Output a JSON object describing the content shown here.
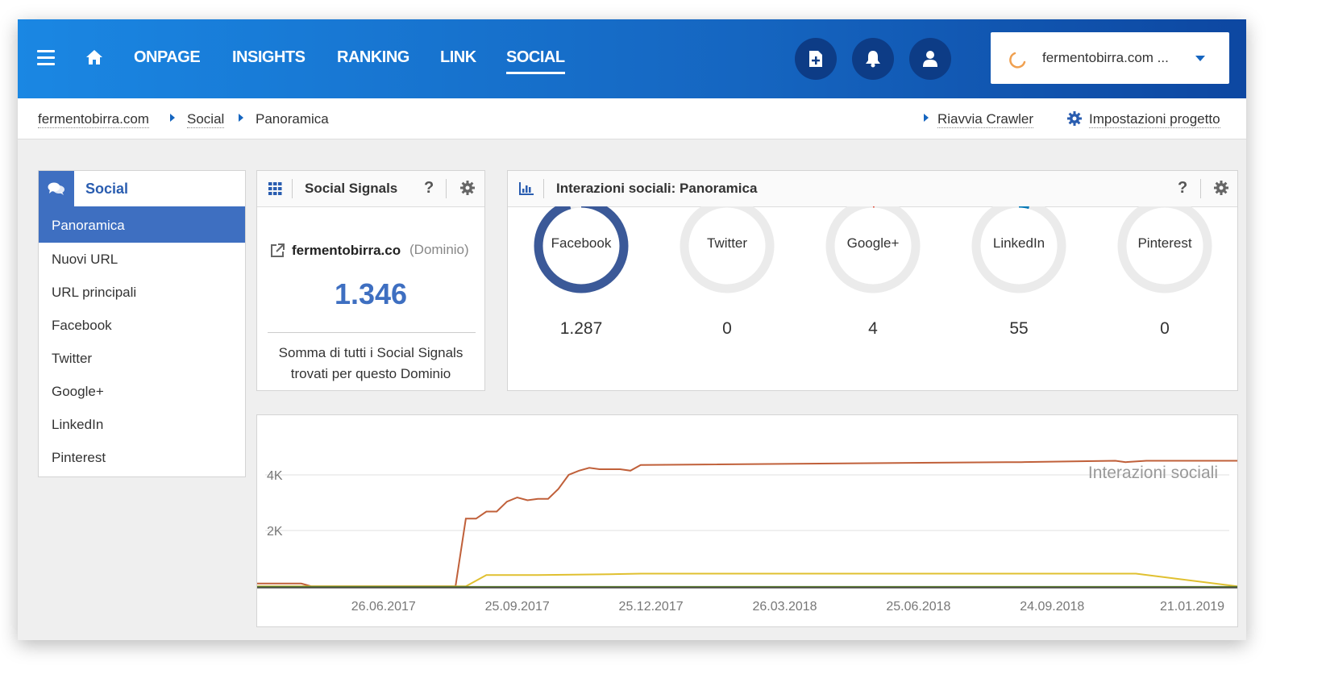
{
  "nav": {
    "items": [
      {
        "label": "ONPAGE",
        "active": false
      },
      {
        "label": "INSIGHTS",
        "active": false
      },
      {
        "label": "RANKING",
        "active": false
      },
      {
        "label": "LINK",
        "active": false
      },
      {
        "label": "SOCIAL",
        "active": true
      }
    ],
    "project": "fermentobirra.com ..."
  },
  "breadcrumb": {
    "items": [
      "fermentobirra.com",
      "Social",
      "Panoramica"
    ],
    "restart": "Riavvia Crawler",
    "settings": "Impostazioni progetto"
  },
  "sidebar": {
    "title": "Social",
    "items": [
      "Panoramica",
      "Nuovi URL",
      "URL principali",
      "Facebook",
      "Twitter",
      "Google+",
      "LinkedIn",
      "Pinterest"
    ],
    "active": "Panoramica"
  },
  "signals": {
    "title": "Social Signals",
    "help": "?",
    "domain": "fermentobirra.co",
    "domain_note": "(Dominio)",
    "value": "1.346",
    "desc_line1": "Somma di tutti i Social Signals",
    "desc_line2": "trovati per questo Dominio"
  },
  "interactions": {
    "title": "Interazioni sociali: Panoramica",
    "help": "?",
    "networks": [
      {
        "name": "Facebook",
        "value": "1.287",
        "share": 0.956,
        "color": "#3b5998"
      },
      {
        "name": "Twitter",
        "value": "0",
        "share": 0,
        "color": "#1da1f2"
      },
      {
        "name": "Google+",
        "value": "4",
        "share": 0.003,
        "color": "#dd4b39"
      },
      {
        "name": "LinkedIn",
        "value": "55",
        "share": 0.041,
        "color": "#0077b5"
      },
      {
        "name": "Pinterest",
        "value": "0",
        "share": 0,
        "color": "#bd081c"
      }
    ]
  },
  "chart_data": {
    "type": "line",
    "title": "Interazioni sociali",
    "x_ticks": [
      "26.06.2017",
      "25.09.2017",
      "25.12.2017",
      "26.03.2018",
      "25.06.2018",
      "24.09.2018",
      "21.01.2019"
    ],
    "y_ticks": [
      "2K",
      "4K"
    ],
    "ylim": [
      0,
      5000
    ],
    "series": [
      {
        "color": "#c0603a",
        "x": [
          "2017-04-01",
          "2017-05-01",
          "2017-05-08",
          "2017-08-14",
          "2017-08-21",
          "2017-08-28",
          "2017-09-04",
          "2017-09-11",
          "2017-09-18",
          "2017-09-25",
          "2017-10-02",
          "2017-10-09",
          "2017-10-16",
          "2017-10-23",
          "2017-10-30",
          "2017-11-06",
          "2017-11-13",
          "2017-11-20",
          "2017-11-27",
          "2017-12-04",
          "2017-12-11",
          "2017-12-18",
          "2018-08-24",
          "2018-09-03",
          "2018-11-06",
          "2018-11-13",
          "2018-11-27",
          "2019-01-28"
        ],
        "y": [
          150,
          150,
          50,
          50,
          2450,
          2450,
          2700,
          2700,
          3050,
          3200,
          3100,
          3150,
          3150,
          3500,
          4000,
          4150,
          4250,
          4200,
          4200,
          4200,
          4150,
          4350,
          4450,
          4450,
          4500,
          4450,
          4500,
          4500
        ]
      },
      {
        "color": "#e0c030",
        "x": [
          "2017-04-01",
          "2017-08-21",
          "2017-09-04",
          "2017-10-09",
          "2017-11-27",
          "2017-12-18",
          "2018-11-06",
          "2018-11-13",
          "2018-11-20",
          "2019-01-28"
        ],
        "y": [
          50,
          50,
          450,
          450,
          480,
          500,
          500,
          500,
          500,
          50
        ]
      },
      {
        "color": "#5a7a30",
        "x": [
          "2017-04-01",
          "2019-01-28"
        ],
        "y": [
          30,
          30
        ]
      }
    ]
  }
}
